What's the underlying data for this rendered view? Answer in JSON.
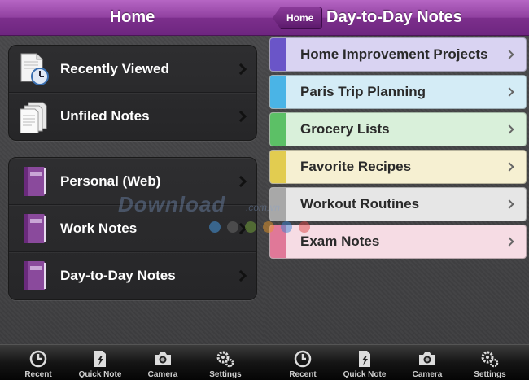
{
  "left": {
    "title": "Home",
    "group1": [
      {
        "label": "Recently Viewed",
        "icon": "recent-doc-icon"
      },
      {
        "label": "Unfiled Notes",
        "icon": "notes-pages-icon"
      }
    ],
    "group2": [
      {
        "label": "Personal (Web)",
        "icon": "notebook-icon"
      },
      {
        "label": "Work Notes",
        "icon": "notebook-icon"
      },
      {
        "label": "Day-to-Day Notes",
        "icon": "notebook-icon"
      }
    ]
  },
  "right": {
    "back_label": "Home",
    "title": "Day-to-Day Notes",
    "sections": [
      {
        "label": "Home Improvement Projects",
        "bg": "#d9d3f2",
        "tab": "#6a55c8"
      },
      {
        "label": "Paris Trip Planning",
        "bg": "#d4ecf6",
        "tab": "#4ab4e6"
      },
      {
        "label": "Grocery Lists",
        "bg": "#d9f0da",
        "tab": "#5cc066"
      },
      {
        "label": "Favorite Recipes",
        "bg": "#f6f0d2",
        "tab": "#e2cc50"
      },
      {
        "label": "Workout Routines",
        "bg": "#e6e6e6",
        "tab": "#a8a8a8"
      },
      {
        "label": "Exam Notes",
        "bg": "#f6dce4",
        "tab": "#e07898"
      }
    ]
  },
  "tabbar": [
    {
      "label": "Recent",
      "icon": "clock-icon"
    },
    {
      "label": "Quick Note",
      "icon": "quick-note-icon"
    },
    {
      "label": "Camera",
      "icon": "camera-icon"
    },
    {
      "label": "Settings",
      "icon": "gears-icon"
    }
  ],
  "watermark": {
    "text": "Download",
    "suffix": ".com.vn"
  },
  "colors": {
    "accent": "#8a3a99"
  }
}
